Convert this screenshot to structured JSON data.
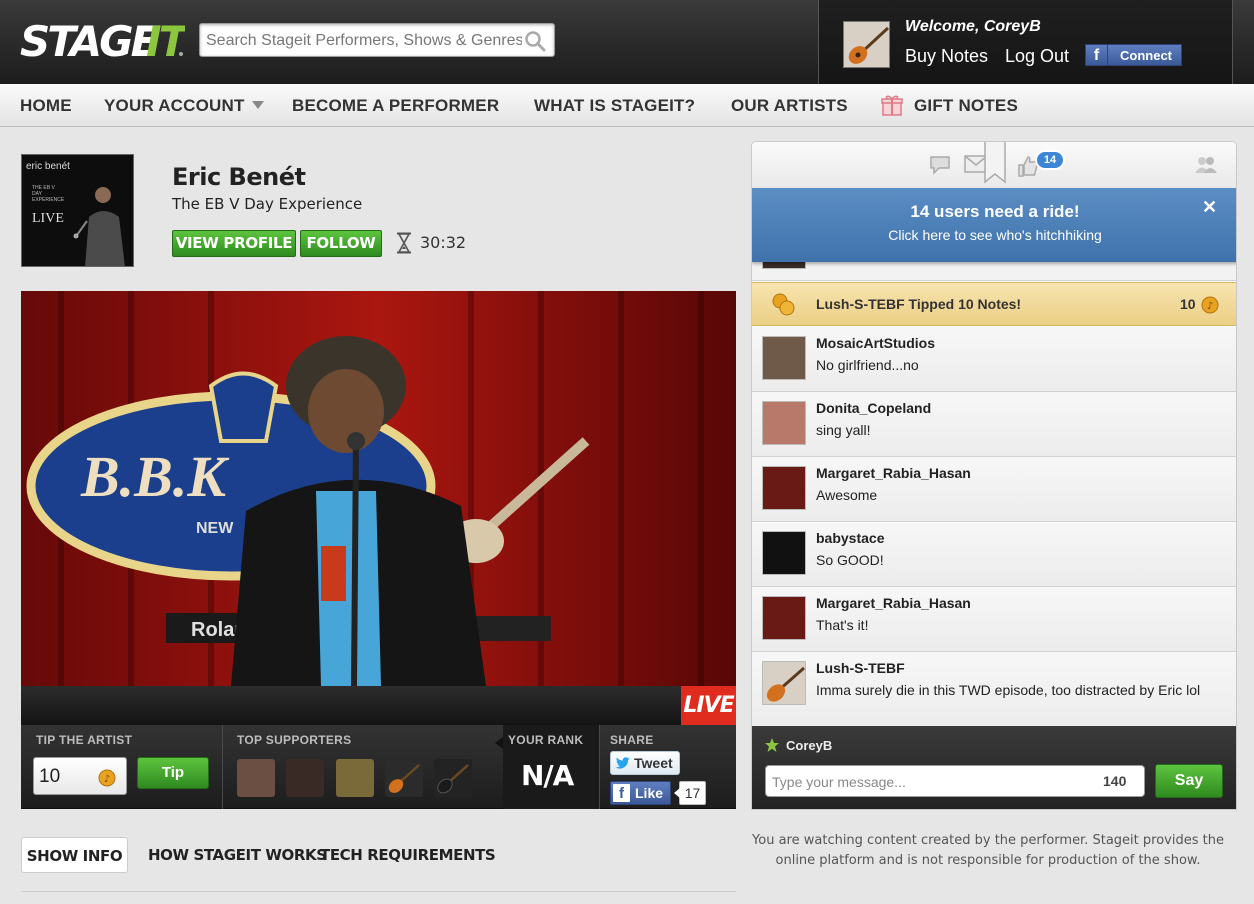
{
  "brand": {
    "logo_text": "STAGEIT",
    "accent": "#3aa02a",
    "live_red": "#e02b1f",
    "banner_blue": "#4a7fb8"
  },
  "search": {
    "placeholder": "Search Stageit Performers, Shows & Genres",
    "icon": "search-icon"
  },
  "user": {
    "welcome": "Welcome, CoreyB",
    "buy_notes": "Buy Notes",
    "logout": "Log Out",
    "fb_connect": "Connect",
    "fb_glyph": "f"
  },
  "nav": {
    "items": [
      "HOME",
      "YOUR ACCOUNT",
      "BECOME A PERFORMER",
      "WHAT IS STAGEIT?",
      "OUR ARTISTS",
      "GIFT NOTES"
    ]
  },
  "show": {
    "art_line1": "eric benét",
    "art_line2": "THE EB V DAY EXPERIENCE",
    "art_line3": "LIVE",
    "artist": "Eric Benét",
    "title": "The EB V Day Experience",
    "view_profile": "VIEW PROFILE",
    "follow": "FOLLOW",
    "timer": "30:32",
    "live_badge": "LIVE"
  },
  "tipbar": {
    "tip_label": "TIP THE ARTIST",
    "tip_value": "10",
    "tip_button": "Tip",
    "supporters_label": "TOP SUPPORTERS",
    "rank_label": "YOUR RANK",
    "rank_value": "N/A",
    "share_label": "SHARE",
    "tweet": "Tweet",
    "like": "Like",
    "like_count": "17"
  },
  "tabs": [
    "SHOW INFO",
    "HOW STAGEIT WORKS",
    "TECH REQUIREMENTS"
  ],
  "disclaimer": "You are watching content created by the performer. Stageit provides the online platform and is not responsible for production of the show.",
  "chat": {
    "fans_count": "14",
    "ride_title": "14 users need a ride!",
    "ride_sub": "Click here to see who's hitchhiking",
    "ride_close": "✕",
    "tip_event": "Lush-S-TEBF Tipped 10 Notes!",
    "tip_amount": "10",
    "messages": [
      {
        "user": "MosaicArtStudios",
        "text": "No girlfriend...no"
      },
      {
        "user": "Donita_Copeland",
        "text": "sing yall!"
      },
      {
        "user": "Margaret_Rabia_Hasan",
        "text": "Awesome"
      },
      {
        "user": "babystace",
        "text": "So GOOD!"
      },
      {
        "user": "Margaret_Rabia_Hasan",
        "text": "That's it!"
      },
      {
        "user": "Lush-S-TEBF",
        "text": "Imma surely die in this TWD episode, too distracted by Eric lol"
      }
    ],
    "current_user": "CoreyB",
    "input_placeholder": "Type your message...",
    "char_count": "140",
    "say": "Say"
  }
}
